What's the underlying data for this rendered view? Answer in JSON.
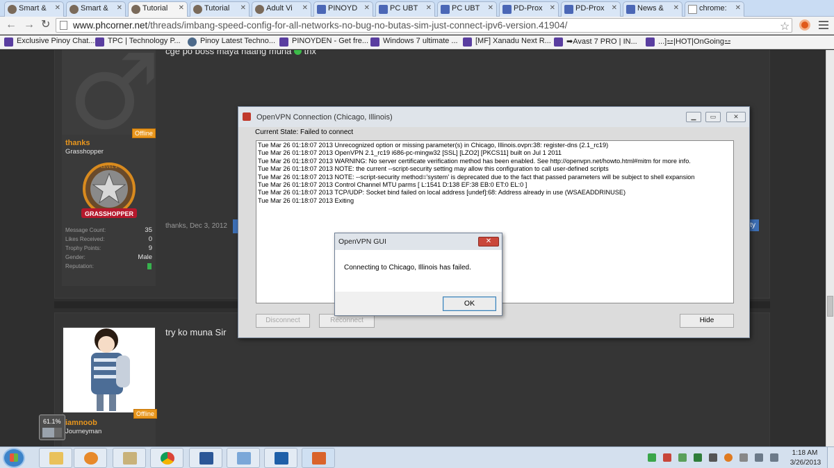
{
  "browser": {
    "tabs": [
      {
        "label": "Smart &",
        "active": false
      },
      {
        "label": "Smart &",
        "active": false
      },
      {
        "label": "Tutorial",
        "active": true
      },
      {
        "label": "Tutorial",
        "active": false
      },
      {
        "label": "Adult Vi",
        "active": false
      },
      {
        "label": "PINOYD",
        "active": false
      },
      {
        "label": "PC UBT",
        "active": false
      },
      {
        "label": "PC UBT",
        "active": false
      },
      {
        "label": "PD-Prox",
        "active": false
      },
      {
        "label": "PD-Prox",
        "active": false
      },
      {
        "label": "News &",
        "active": false
      },
      {
        "label": "chrome:",
        "active": false
      }
    ],
    "url_domain": "www.phcorner.net",
    "url_path": "/threads/imbang-speed-config-for-all-networks-no-bug-no-butas-sim-just-connect-ipv6-version.41904/",
    "bookmarks": [
      "Exclusive Pinoy Chat...",
      "TPC | Technology P...",
      "Pinoy Latest Techno...",
      "PINOYDEN - Get fre...",
      "Windows 7 ultimate ...",
      "[MF] Xanadu Next R...",
      "➡Avast 7 PRO | IN...",
      "...]⚍|HOT|OnGoing⚍"
    ]
  },
  "forum": {
    "post1": {
      "text": "cge po boss maya naang muna",
      "text_suffix": "thx",
      "status": "Offline",
      "username": "thanks",
      "rank": "Grasshopper",
      "badge_label": "GRASSHOPPER",
      "badge_level": "LEVEL 1",
      "stats": [
        {
          "label": "Message Count:",
          "value": "35"
        },
        {
          "label": "Likes Received:",
          "value": "0"
        },
        {
          "label": "Trophy Points:",
          "value": "9"
        },
        {
          "label": "Gender:",
          "value": "Male"
        },
        {
          "label": "Reputation:",
          "value": ""
        }
      ],
      "date": "thanks, Dec 3, 2012",
      "like_partial": "ity"
    },
    "post2": {
      "text": "try ko muna Sir",
      "status": "Offline",
      "username": "iamnoob",
      "rank": "Journeyman"
    }
  },
  "progress_widget": {
    "label": "61.1%",
    "value_percent": 61.1
  },
  "vpn_window": {
    "title": "OpenVPN Connection (Chicago, Illinois)",
    "state": "Current State: Failed to connect",
    "log": [
      "Tue Mar 26 01:18:07 2013 Unrecognized option or missing parameter(s) in Chicago, Illinois.ovpn:38: register-dns (2.1_rc19)",
      "Tue Mar 26 01:18:07 2013 OpenVPN 2.1_rc19 i686-pc-mingw32 [SSL] [LZO2] [PKCS11] built on Jul  1 2011",
      "Tue Mar 26 01:18:07 2013 WARNING: No server certificate verification method has been enabled.  See http://openvpn.net/howto.html#mitm for more info.",
      "Tue Mar 26 01:18:07 2013 NOTE: the current --script-security setting may allow this configuration to call user-defined scripts",
      "Tue Mar 26 01:18:07 2013 NOTE: --script-security method='system' is deprecated due to the fact that passed parameters will be subject to shell expansion",
      "Tue Mar 26 01:18:07 2013 Control Channel MTU parms [ L:1541 D:138 EF:38 EB:0 ET:0 EL:0 ]",
      "Tue Mar 26 01:18:07 2013 TCP/UDP: Socket bind failed on local address [undef]:68: Address already in use (WSAEADDRINUSE)",
      "Tue Mar 26 01:18:07 2013 Exiting"
    ],
    "buttons": {
      "disconnect": "Disconnect",
      "reconnect": "Reconnect",
      "hide": "Hide"
    }
  },
  "dialog": {
    "title": "OpenVPN GUI",
    "message": "Connecting to Chicago, Illinois has failed.",
    "ok": "OK"
  },
  "taskbar": {
    "time": "1:18 AM",
    "date": "3/26/2013"
  },
  "colors": {
    "accent_orange": "#e8961d",
    "forum_bg": "#2f2f2f",
    "like_blue": "#3d6fb5"
  }
}
